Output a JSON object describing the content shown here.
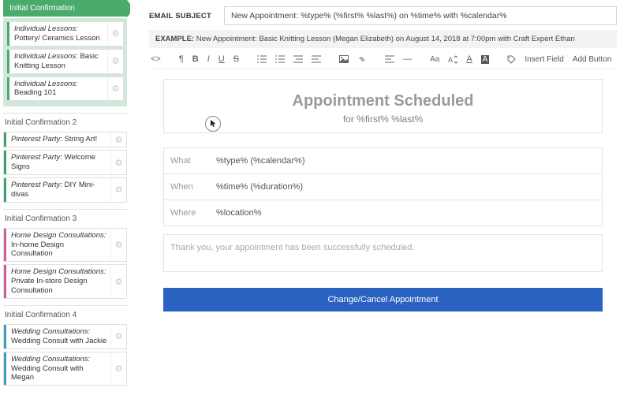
{
  "sidebar": {
    "groups": [
      {
        "title": "Initial Confirmation",
        "active": true,
        "items": [
          {
            "cat": "Individual Lessons:",
            "name": "Pottery/ Ceramics Lesson",
            "stripe": "#4aab6d"
          },
          {
            "cat": "Individual Lessons:",
            "name": "Basic Knitting Lesson",
            "stripe": "#4aab6d"
          },
          {
            "cat": "Individual Lessons:",
            "name": "Beading 101",
            "stripe": "#4aab6d"
          }
        ]
      },
      {
        "title": "Initial Confirmation 2",
        "items": [
          {
            "cat": "Pinterest Party:",
            "name": "String Art!",
            "stripe": "#3ea46a"
          },
          {
            "cat": "Pinterest Party:",
            "name": "Welcome Signs",
            "stripe": "#3ea46a"
          },
          {
            "cat": "Pinterest Party:",
            "name": "DIY Mini-divas",
            "stripe": "#3ea46a"
          }
        ]
      },
      {
        "title": "Initial Confirmation 3",
        "items": [
          {
            "cat": "Home Design Consultations:",
            "name": "In-home Design Consultation",
            "stripe": "#cf5a9c"
          },
          {
            "cat": "Home Design Consultations:",
            "name": "Private In-store Design Consultation",
            "stripe": "#cf5a9c"
          }
        ]
      },
      {
        "title": "Initial Confirmation 4",
        "items": [
          {
            "cat": "Wedding Consultations:",
            "name": "Wedding Consult with Jackie",
            "stripe": "#3aa0b7"
          },
          {
            "cat": "Wedding Consultations:",
            "name": "Wedding Consult with Megan",
            "stripe": "#3aa0b7"
          }
        ]
      }
    ]
  },
  "main": {
    "subject_label": "EMAIL SUBJECT",
    "subject_value": "New Appointment: %type% (%first% %last%) on %time% with %calendar%",
    "example_label": "EXAMPLE:",
    "example_text": "New Appointment: Basic Knitting Lesson (Megan Elizabeth) on August 14, 2018 at 7:00pm with Craft Expert Ethan",
    "toolbar": {
      "insert_field": "Insert Field",
      "add_button": "Add Button"
    },
    "editor": {
      "title": "Appointment Scheduled",
      "for_line": "for %first% %last%",
      "rows": [
        {
          "label": "What",
          "value": "%type% (%calendar%)"
        },
        {
          "label": "When",
          "value": "%time% (%duration%)"
        },
        {
          "label": "Where",
          "value": "%location%"
        }
      ],
      "thanks": "Thank you, your appointment has been successfully scheduled.",
      "cta": "Change/Cancel Appointment"
    }
  },
  "colors": {
    "accent": "#2a62c1",
    "green": "#4aab6d"
  }
}
